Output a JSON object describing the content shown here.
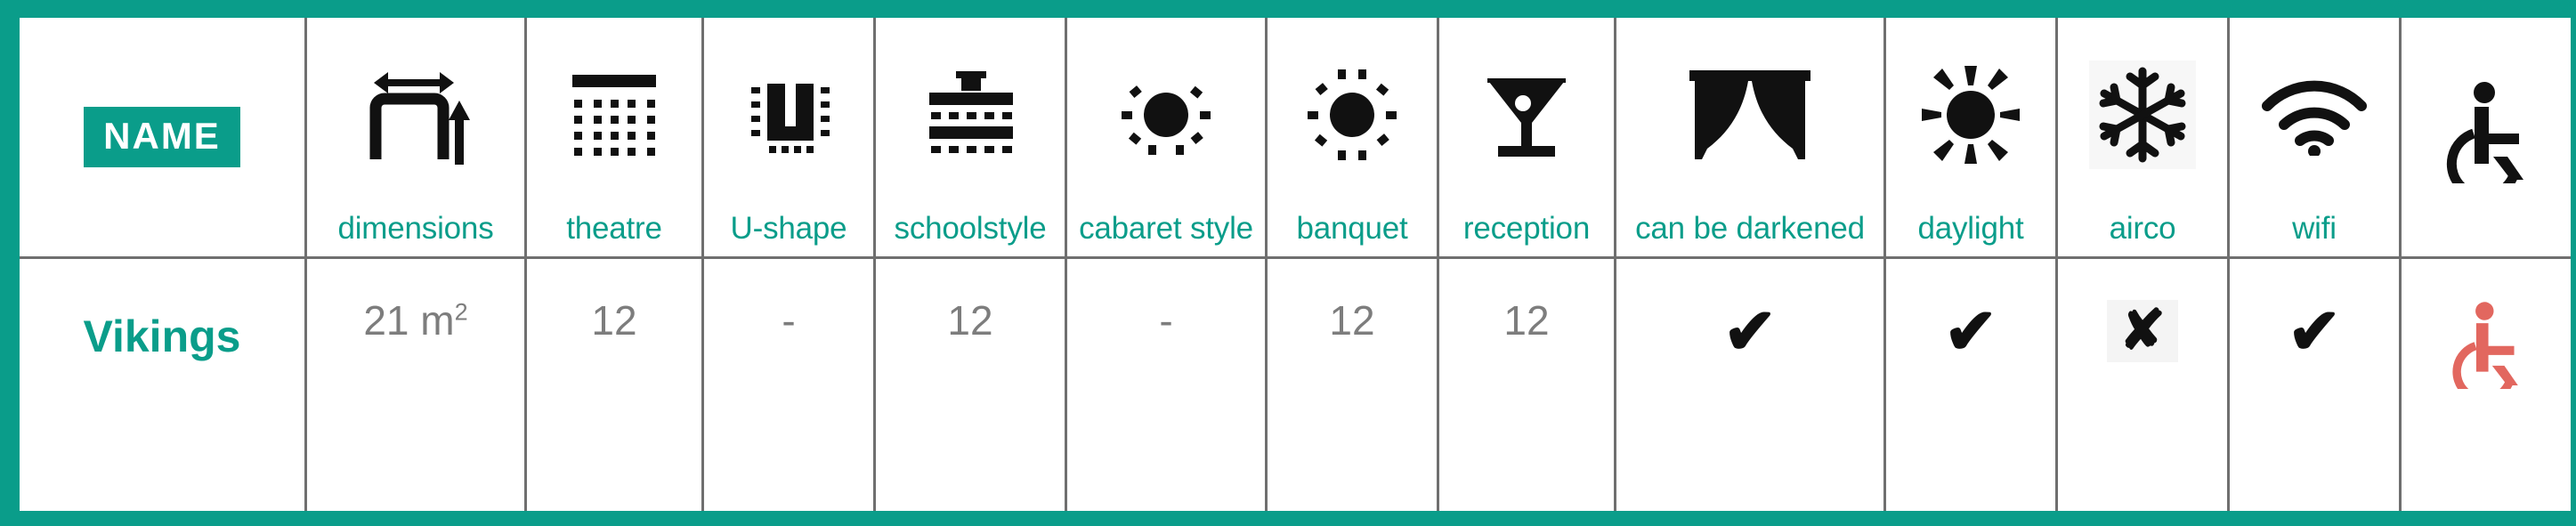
{
  "theme": {
    "accent": "#0a9d8a",
    "border": "#6f6f6f",
    "value_text": "#7d7d7d",
    "mark": "#111111",
    "accessible_icon": "#e2675f"
  },
  "table": {
    "name_badge": "NAME",
    "columns": [
      {
        "key": "name",
        "label": "",
        "icon": "name-badge"
      },
      {
        "key": "dimensions",
        "label": "dimensions",
        "icon": "dimensions-icon"
      },
      {
        "key": "theatre",
        "label": "theatre",
        "icon": "theatre-layout-icon"
      },
      {
        "key": "ushape",
        "label": "U-shape",
        "icon": "u-shape-layout-icon"
      },
      {
        "key": "school",
        "label": "schoolstyle",
        "icon": "schoolstyle-layout-icon"
      },
      {
        "key": "cabaret",
        "label": "cabaret style",
        "icon": "cabaret-layout-icon"
      },
      {
        "key": "banquet",
        "label": "banquet",
        "icon": "banquet-layout-icon"
      },
      {
        "key": "reception",
        "label": "reception",
        "icon": "cocktail-glass-icon"
      },
      {
        "key": "darkened",
        "label": "can be darkened",
        "icon": "curtain-icon"
      },
      {
        "key": "daylight",
        "label": "daylight",
        "icon": "sun-icon"
      },
      {
        "key": "airco",
        "label": "airco",
        "icon": "snowflake-icon"
      },
      {
        "key": "wifi",
        "label": "wifi",
        "icon": "wifi-icon"
      },
      {
        "key": "accessible",
        "label": "",
        "icon": "wheelchair-icon"
      }
    ],
    "rows": [
      {
        "name": "Vikings",
        "dimensions_value": "21 m",
        "dimensions_unit": "2",
        "theatre": "12",
        "ushape": "-",
        "school": "12",
        "cabaret": "-",
        "banquet": "12",
        "reception": "12",
        "darkened": "✔",
        "daylight": "✔",
        "airco": "✘",
        "wifi": "✔",
        "accessible": "wheelchair-icon"
      }
    ]
  }
}
